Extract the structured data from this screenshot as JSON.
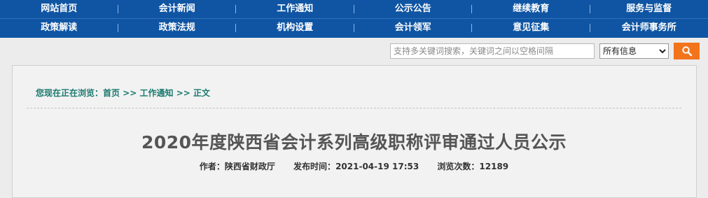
{
  "nav": {
    "row1": [
      "网站首页",
      "会计新闻",
      "工作通知",
      "公示公告",
      "继续教育",
      "服务与监督"
    ],
    "row2": [
      "政策解读",
      "政策法规",
      "机构设置",
      "会计领军",
      "意见征集",
      "会计师事务所"
    ]
  },
  "search": {
    "placeholder": "支持多关键词搜索，关键词之间以空格间隔",
    "scope_selected": "所有信息"
  },
  "breadcrumb": {
    "prefix": "您现在正在浏览：",
    "home": "首页",
    "sep1": " >> ",
    "section": "工作通知",
    "sep2": " >> ",
    "current": "正文"
  },
  "article": {
    "title": "2020年度陕西省会计系列高级职称评审通过人员公示",
    "author_label": "作者：",
    "author": "陕西省财政厅",
    "date_label": "发布时间：",
    "date": "2021-04-19 17:53",
    "views_label": "浏览次数：",
    "views": "12189"
  },
  "colors": {
    "nav_bg": "#0f55a3",
    "search_button": "#f2741b",
    "breadcrumb": "#1a7a70"
  },
  "icons": {
    "search_button": "search-icon"
  }
}
